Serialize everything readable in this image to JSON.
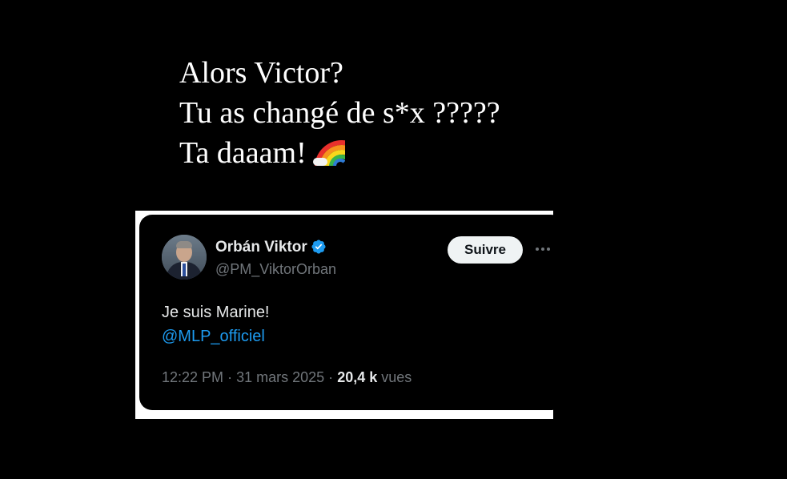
{
  "caption": {
    "line1": "Alors Victor?",
    "line2": "Tu as changé de s*x ?????",
    "line3": "Ta daaam!",
    "emoji": "rainbow-icon"
  },
  "tweet": {
    "author_name": "Orbán Viktor",
    "handle": "@PM_ViktorOrban",
    "verified_icon": "verified-badge-icon",
    "follow_label": "Suivre",
    "more_icon": "more-options-icon",
    "text": "Je suis Marine!",
    "mention": "@MLP_officiel",
    "time": "12:22 PM",
    "separator": "·",
    "date": "31 mars 2025",
    "views_count": "20,4 k",
    "views_label": "vues"
  },
  "colors": {
    "background": "#000000",
    "text_primary": "#e7e9ea",
    "text_secondary": "#71767b",
    "link": "#1d9bf0",
    "verified": "#1d9bf0"
  }
}
